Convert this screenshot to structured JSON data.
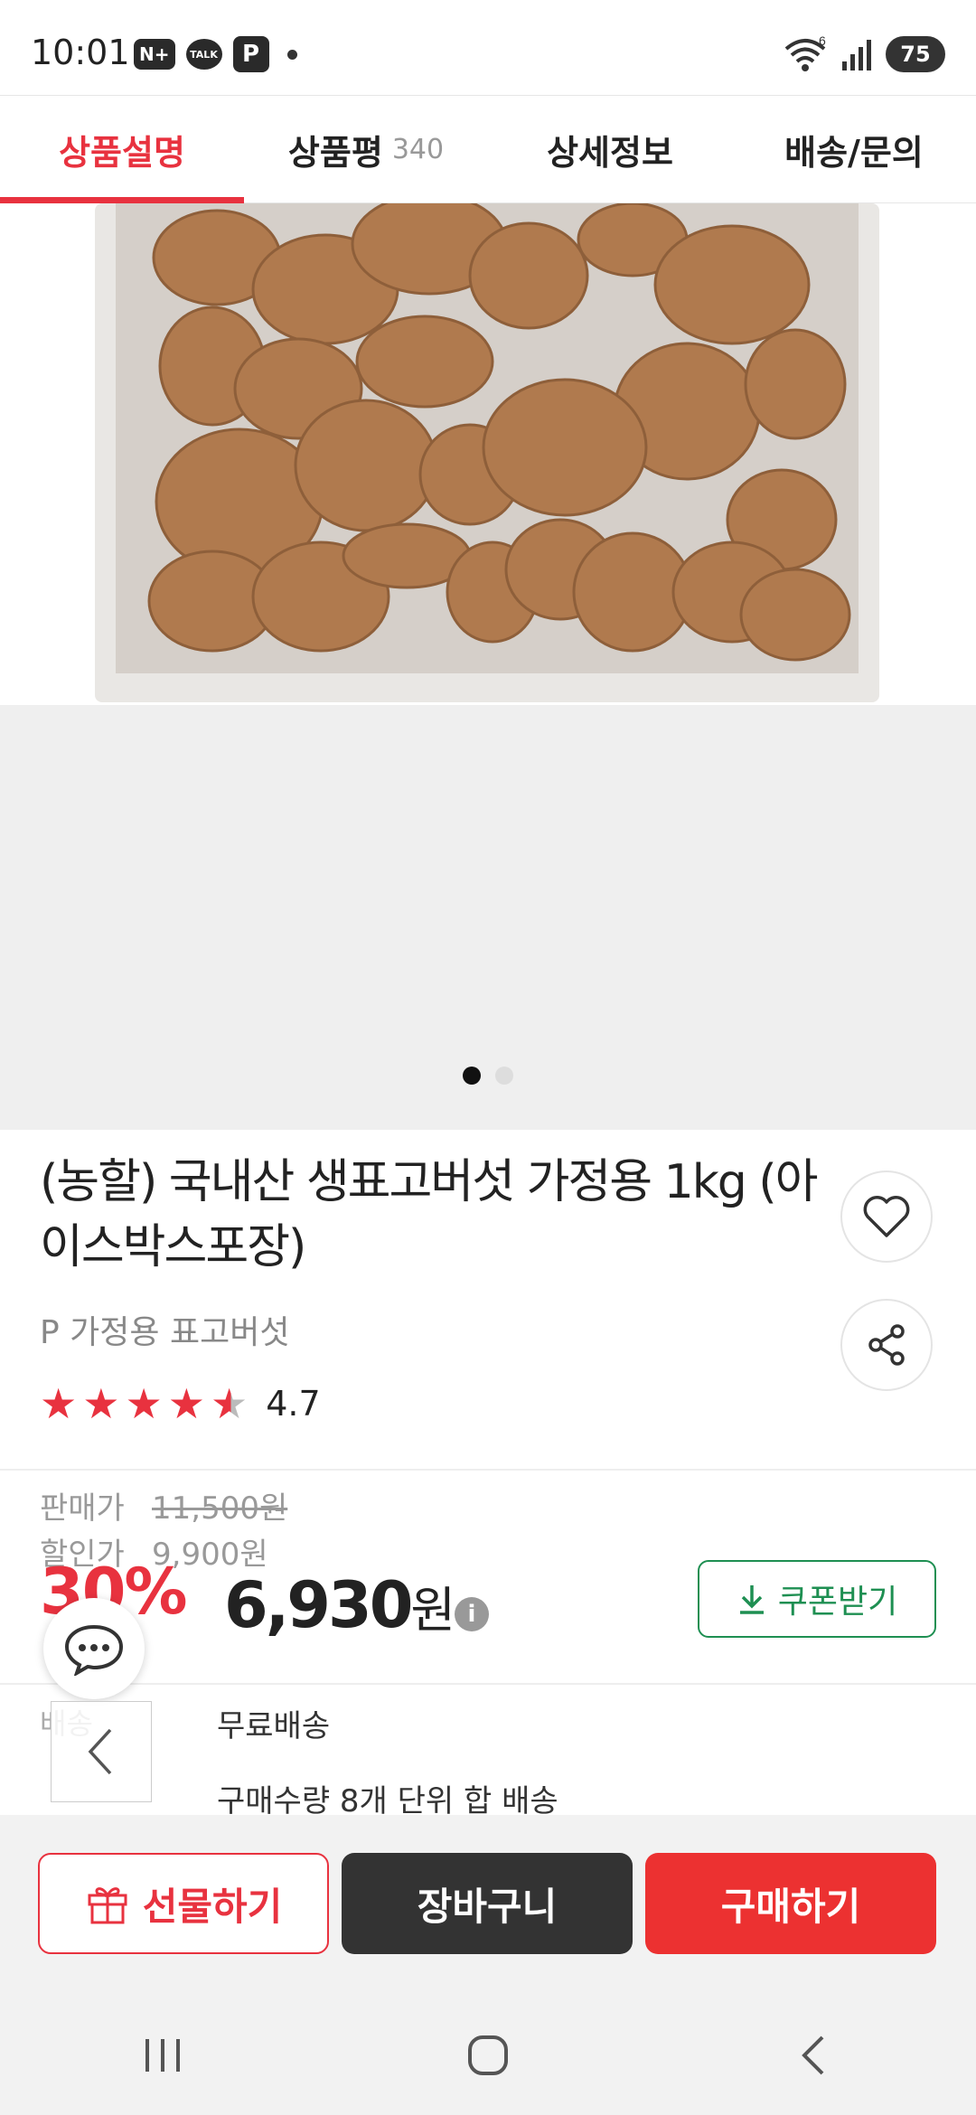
{
  "status_bar": {
    "time": "10:01",
    "naver_badge": "N+",
    "talk_badge": "TALK",
    "p_badge": "P",
    "battery": "75",
    "wifi_sub": "6"
  },
  "tabs": [
    {
      "label": "상품설명",
      "active": true
    },
    {
      "label": "상품평",
      "count": "340"
    },
    {
      "label": "상세정보"
    },
    {
      "label": "배송/문의"
    }
  ],
  "carousel": {
    "total": 2,
    "active_index": 0
  },
  "product": {
    "title": "(농할) 국내산 생표고버섯 가정용 1kg (아이스박스포장)",
    "subtitle": "P 가정용 표고버섯",
    "rating_value": "4.7",
    "rating_stars": 4.7
  },
  "price": {
    "sale_label": "판매가",
    "sale_value": "11,500원",
    "discount_label": "할인가",
    "discount_value": "9,900원",
    "discount_rate": "30%",
    "final_amount": "6,930",
    "final_unit": "원",
    "info_icon": "i",
    "coupon_label": "쿠폰받기"
  },
  "shipping": {
    "label": "배송",
    "value": "무료배송",
    "note": "구매수량 8개 단위 합 배송"
  },
  "actions": {
    "gift": "선물하기",
    "cart": "장바구니",
    "buy": "구매하기"
  },
  "colors": {
    "accent": "#e8323f",
    "coupon": "#1e8f52",
    "cart_bg": "#333333",
    "buy_bg": "#ec3131"
  }
}
